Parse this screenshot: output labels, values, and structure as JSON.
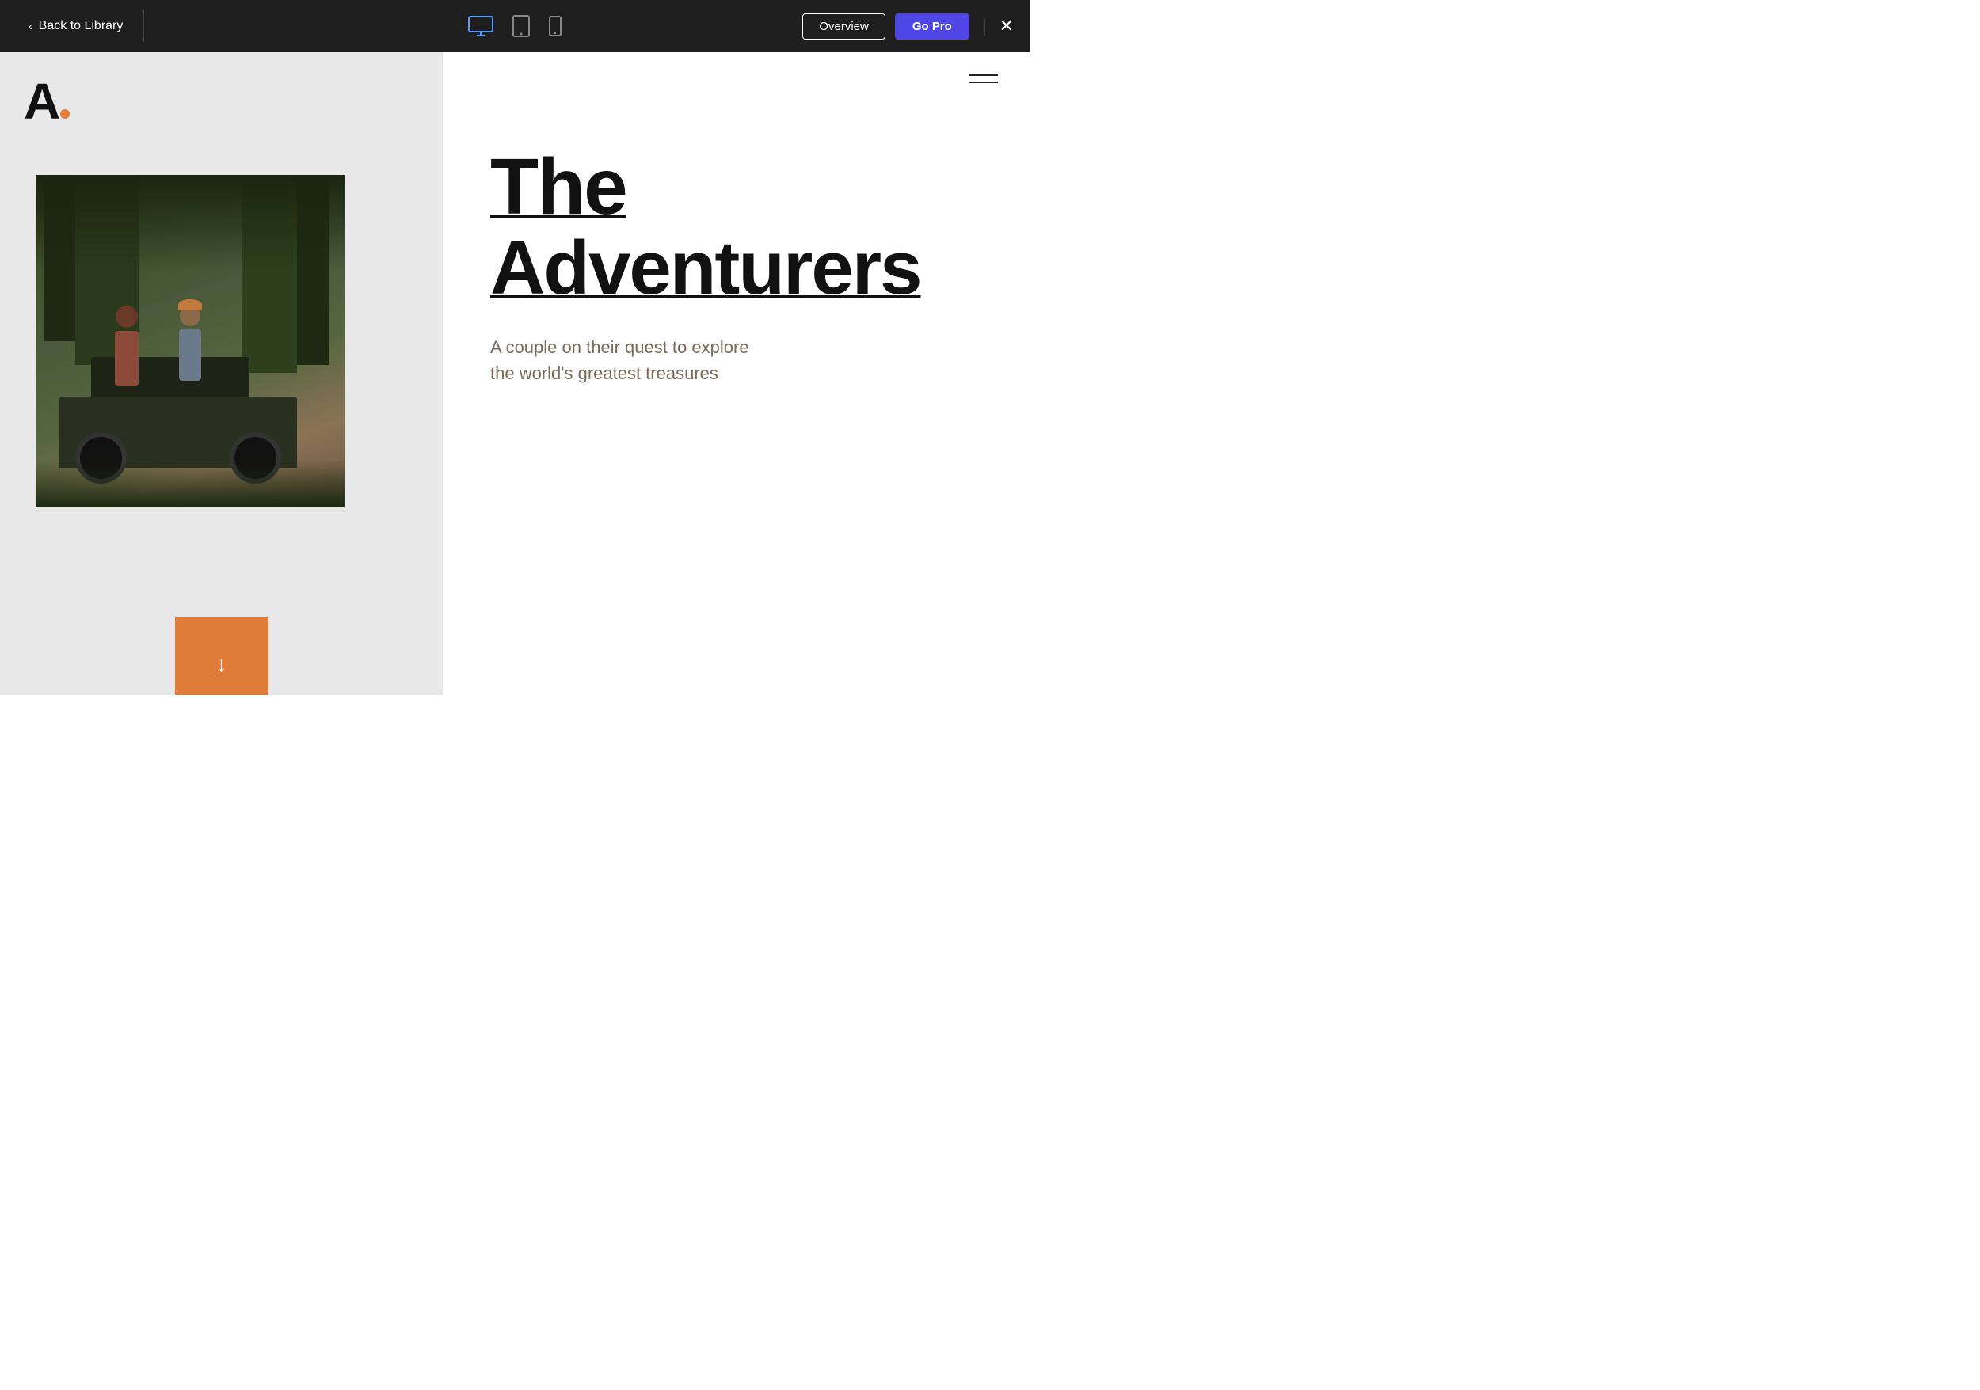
{
  "topbar": {
    "back_label": "Back to Library",
    "overview_label": "Overview",
    "gopro_label": "Go Pro"
  },
  "devices": {
    "desktop_label": "desktop",
    "tablet_label": "tablet",
    "mobile_label": "mobile"
  },
  "logo": {
    "letter": "A",
    "dot_color": "#e07b39"
  },
  "hero": {
    "title_line1": "The",
    "title_line2": "Adventurers",
    "subtitle_line1": "A couple on their quest to explore",
    "subtitle_line2": "the world's greatest treasures"
  },
  "scroll_btn": {
    "arrow": "↓"
  },
  "colors": {
    "accent_orange": "#e07b39",
    "accent_blue": "#4f46e5",
    "topbar_bg": "#1e1e1e",
    "left_panel_bg": "#e8e8e8",
    "right_panel_bg": "#ffffff"
  }
}
